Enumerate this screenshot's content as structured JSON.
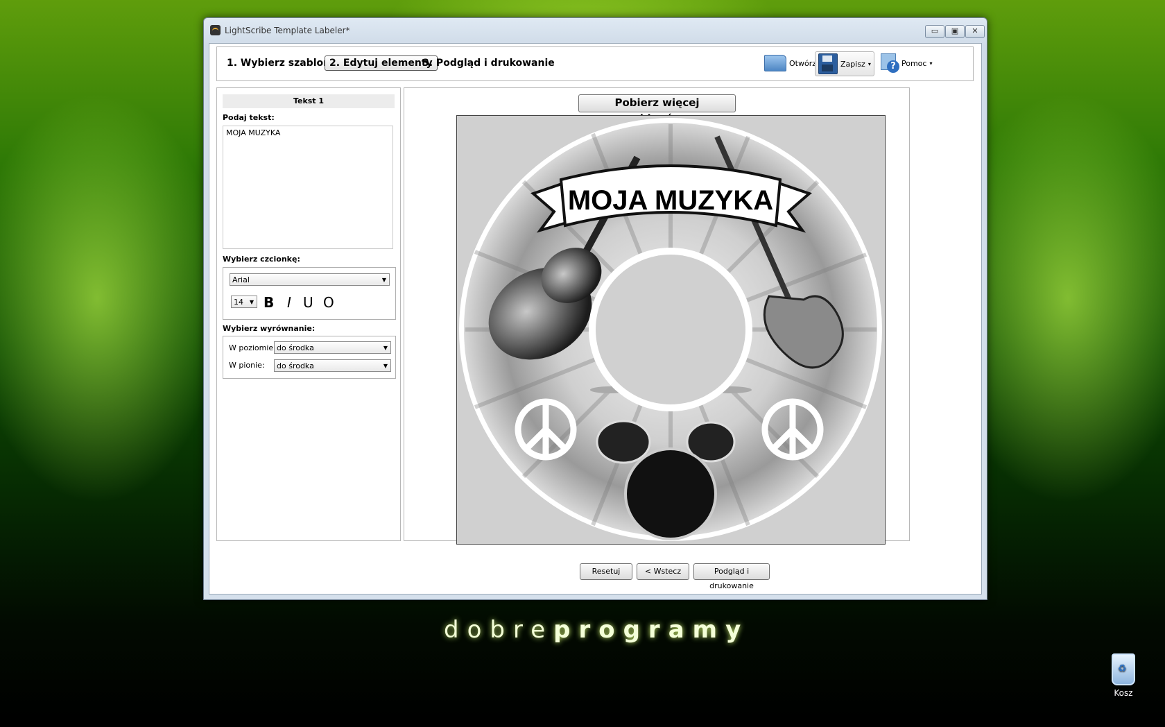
{
  "window": {
    "title": "LightScribe Template Labeler*",
    "minimize": "▭",
    "maximize": "▣",
    "close": "✕"
  },
  "steps": [
    {
      "label": "1. Wybierz szablon"
    },
    {
      "label": "2. Edytuj elementy"
    },
    {
      "label": "3. Podgląd i drukowanie"
    }
  ],
  "toolbar": {
    "open": "Otwórz",
    "save": "Zapisz",
    "help": "Pomoc",
    "dropdown": "▾"
  },
  "left": {
    "section_title": "Tekst 1",
    "text_label": "Podaj tekst:",
    "text_value": "MOJA MUZYKA",
    "font_label": "Wybierz czcionkę:",
    "font_value": "Arial",
    "size_value": "14",
    "bold": "B",
    "italic": "I",
    "underline": "U",
    "outline": "O",
    "align_label": "Wybierz wyrównanie:",
    "h_label": "W poziomie:",
    "h_value": "do środka",
    "v_label": "W pionie:",
    "v_value": "do środka"
  },
  "right": {
    "get_more": "Pobierz więcej szablonów...",
    "disc_title": "MOJA MUZYKA",
    "reset": "Resetuj",
    "back": "< Wstecz",
    "preview": "Podgląd i drukowanie"
  },
  "desktop": {
    "brand_light": "dobre",
    "brand_bold": "programy",
    "recycle_bin": "Kosz"
  },
  "colors": {
    "desktop_green": "#2f7a06",
    "window_frame": "#cfdbe8"
  }
}
